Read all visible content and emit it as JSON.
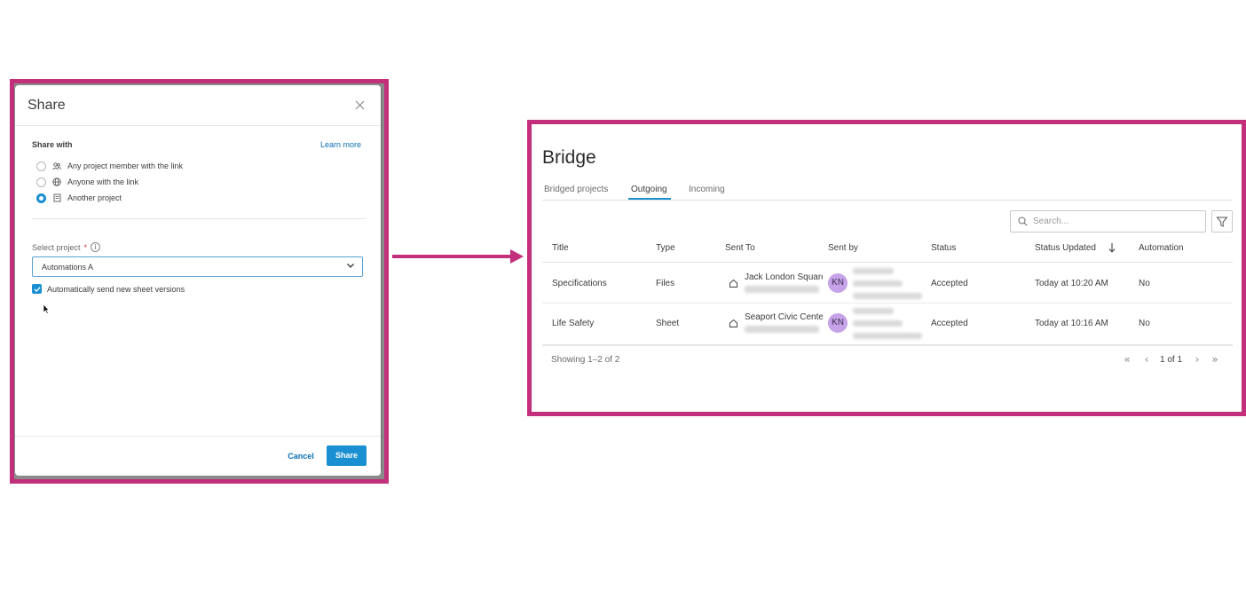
{
  "share_dialog": {
    "title": "Share",
    "share_with_label": "Share with",
    "learn_more": "Learn more",
    "options": [
      {
        "label": "Any project member with the link",
        "icon": "people-icon",
        "selected": false
      },
      {
        "label": "Anyone with the link",
        "icon": "globe-icon",
        "selected": false
      },
      {
        "label": "Another project",
        "icon": "project-icon",
        "selected": true
      }
    ],
    "select_project_label": "Select project",
    "required_mark": "*",
    "selected_project": "Automations A",
    "auto_send_label": "Automatically send new sheet versions",
    "auto_send_checked": true,
    "cancel_label": "Cancel",
    "share_label": "Share"
  },
  "bridge": {
    "title": "Bridge",
    "tabs": [
      {
        "label": "Bridged projects",
        "active": false
      },
      {
        "label": "Outgoing",
        "active": true
      },
      {
        "label": "Incoming",
        "active": false
      }
    ],
    "search_placeholder": "Search...",
    "columns": [
      "Title",
      "Type",
      "Sent To",
      "Sent by",
      "Status",
      "Status Updated",
      "Automation"
    ],
    "rows": [
      {
        "title": "Specifications",
        "type": "Files",
        "sent_to": "Jack London Square",
        "sent_by_initials": "KN",
        "status": "Accepted",
        "status_updated": "Today at 10:20 AM",
        "automation": "No"
      },
      {
        "title": "Life Safety",
        "type": "Sheet",
        "sent_to": "Seaport Civic Center",
        "sent_by_initials": "KN",
        "status": "Accepted",
        "status_updated": "Today at 10:16 AM",
        "automation": "No"
      }
    ],
    "showing": "Showing 1–2 of 2",
    "page_info": "1 of 1"
  },
  "colors": {
    "highlight_frame": "#c2307b",
    "accent": "#1a8fd1",
    "avatar": "#c6a3e8"
  }
}
